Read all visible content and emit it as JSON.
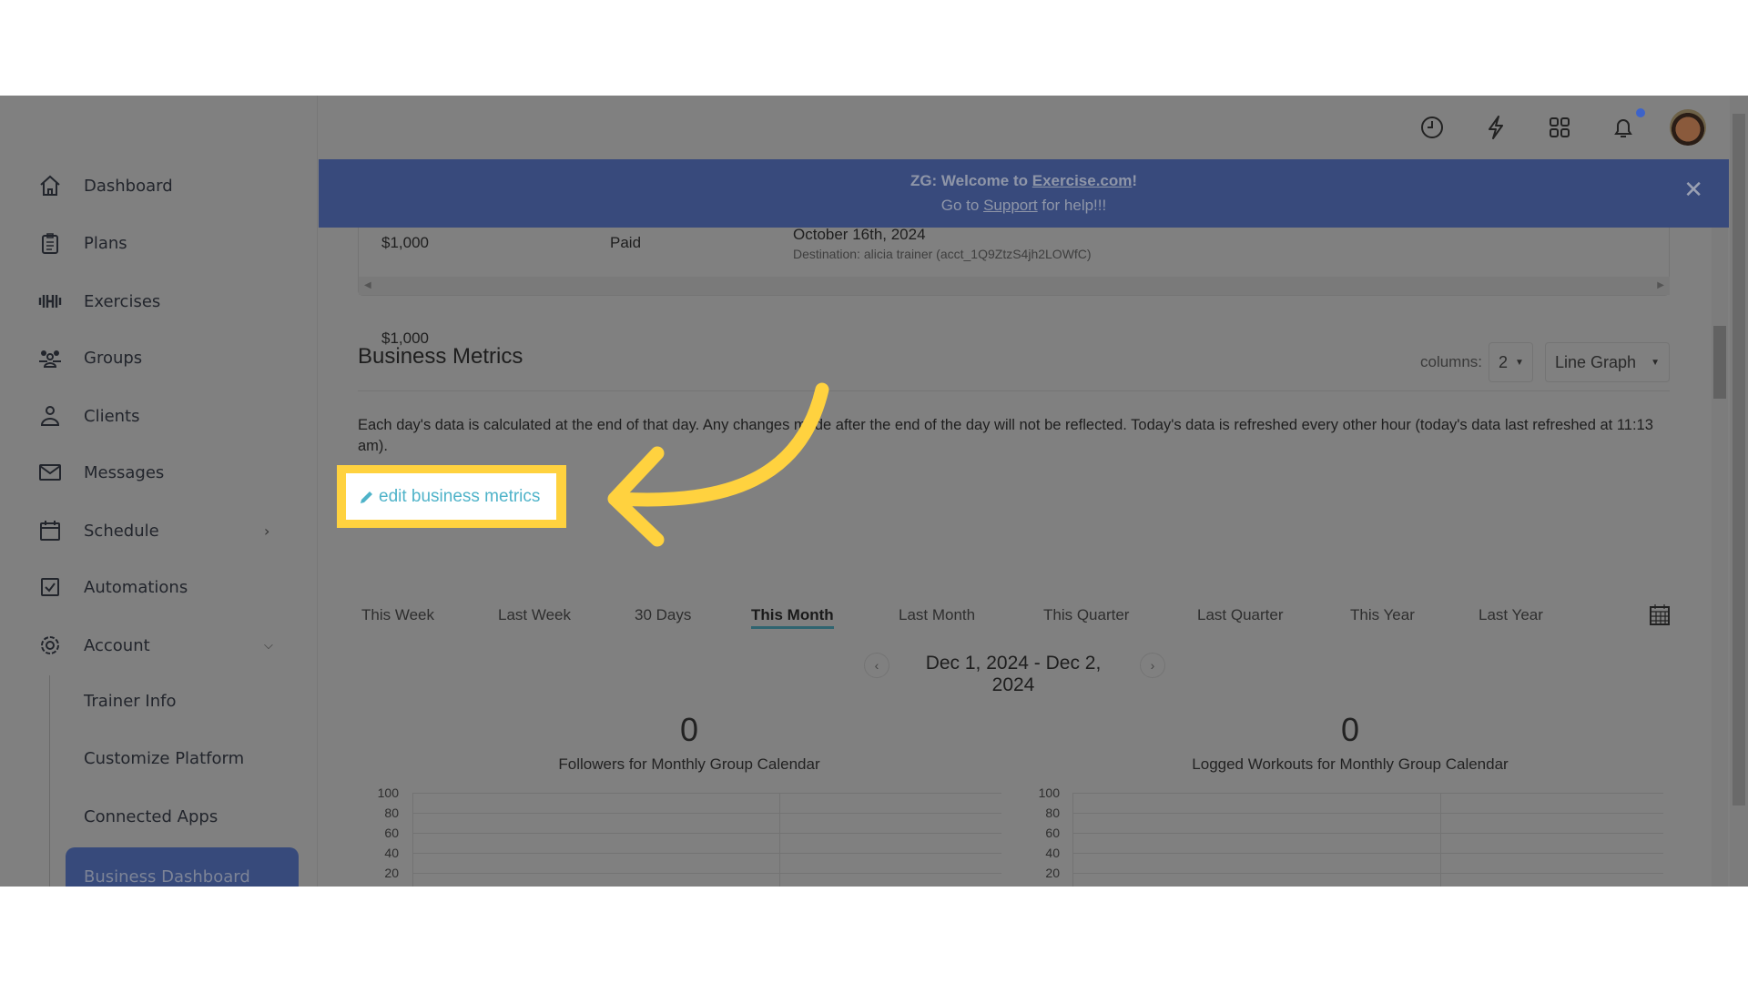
{
  "sidebar": {
    "items": [
      {
        "label": "Dashboard",
        "icon": "home-icon"
      },
      {
        "label": "Plans",
        "icon": "clipboard-icon"
      },
      {
        "label": "Exercises",
        "icon": "dumbbell-icon"
      },
      {
        "label": "Groups",
        "icon": "groups-icon"
      },
      {
        "label": "Clients",
        "icon": "user-icon"
      },
      {
        "label": "Messages",
        "icon": "envelope-icon"
      },
      {
        "label": "Schedule",
        "icon": "calendar-icon"
      },
      {
        "label": "Automations",
        "icon": "checkbox-icon"
      },
      {
        "label": "Account",
        "icon": "gear-icon"
      }
    ],
    "account_sub": [
      "Trainer Info",
      "Customize Platform",
      "Connected Apps",
      "Business Dashboard"
    ],
    "active": "Business Dashboard"
  },
  "header": {
    "icons": [
      "clock-icon",
      "lightning-icon",
      "apps-grid-icon",
      "bell-icon",
      "avatar"
    ],
    "notification_dot_color": "#3d63c9"
  },
  "banner": {
    "prefix": "ZG: Welcome to ",
    "link1": "Exercise.com",
    "suffix1": "!",
    "line2_prefix": "Go to ",
    "link2": "Support",
    "line2_suffix": " for help!!!",
    "bg": "#384a7c"
  },
  "payout_row": {
    "amount": "$1,000",
    "status": "Paid",
    "date": "October 16th, 2024",
    "destination": "Destination: alicia trainer (acct_1Q9ZtzS4jh2LOWfC)"
  },
  "metrics": {
    "title": "Business Metrics",
    "columns_label": "columns:",
    "columns_value": "2",
    "graph_type": "Line Graph",
    "description": "Each day's data is calculated at the end of that day. Any changes made after the end of the day will not be reflected. Today's data is refreshed every other hour (today's data last refreshed at 11:13 am).",
    "edit_link": "edit business metrics",
    "tabs": [
      "This Week",
      "Last Week",
      "30 Days",
      "This Month",
      "Last Month",
      "This Quarter",
      "Last Quarter",
      "This Year",
      "Last Year"
    ],
    "active_tab": "This Month",
    "date_range": "Dec 1, 2024 - Dec 2, 2024"
  },
  "chart_data": [
    {
      "type": "line",
      "value": "0",
      "title": "Followers for Monthly Group Calendar",
      "yticks": [
        "100",
        "80",
        "60",
        "40",
        "20"
      ],
      "ylim": [
        0,
        100
      ],
      "series": [],
      "grid": true
    },
    {
      "type": "line",
      "value": "0",
      "title": "Logged Workouts for Monthly Group Calendar",
      "yticks": [
        "100",
        "80",
        "60",
        "40",
        "20"
      ],
      "ylim": [
        0,
        100
      ],
      "series": [],
      "grid": true
    }
  ],
  "colors": {
    "highlight": "#ffd23f",
    "link": "#4fb3c9",
    "tab_underline": "#2f6470"
  }
}
